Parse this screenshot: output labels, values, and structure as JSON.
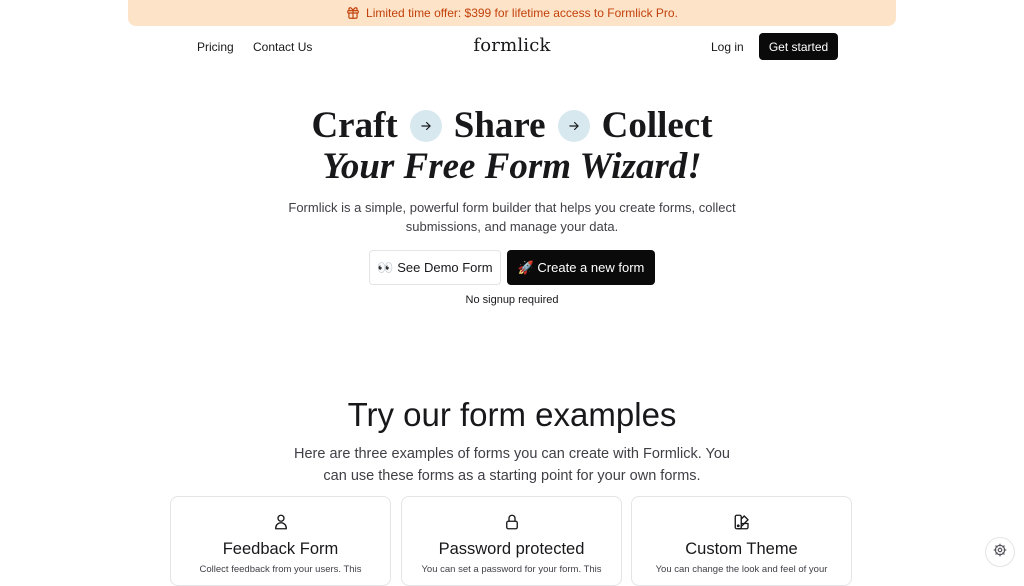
{
  "banner": {
    "icon": "gift-icon",
    "text": "Limited time offer: $399 for lifetime access to Formlick Pro."
  },
  "nav": {
    "links": [
      "Pricing",
      "Contact Us"
    ],
    "logo": "formlick",
    "login": "Log in",
    "cta": "Get started"
  },
  "hero": {
    "words": [
      "Craft",
      "Share",
      "Collect"
    ],
    "tagline": "Your Free Form Wizard!",
    "description": "Formlick is a simple, powerful form builder that helps you create forms, collect submissions, and manage your data.",
    "demo_button": "👀 See Demo Form",
    "create_button": "🚀 Create a new form",
    "note": "No signup required"
  },
  "examples": {
    "title": "Try our form examples",
    "description": "Here are three examples of forms you can create with Formlick. You can use these forms as a starting point for your own forms.",
    "cards": [
      {
        "icon": "user-icon",
        "title": "Feedback Form",
        "desc": "Collect feedback from your users. This"
      },
      {
        "icon": "lock-icon",
        "title": "Password protected",
        "desc": "You can set a password for your form. This"
      },
      {
        "icon": "palette-icon",
        "title": "Custom Theme",
        "desc": "You can change the look and feel of your"
      }
    ]
  },
  "colors": {
    "banner_bg": "#fde4c8",
    "banner_text": "#c2410c",
    "arrow_chip": "#d7e9ef",
    "dark_button": "#0a0a0a"
  }
}
